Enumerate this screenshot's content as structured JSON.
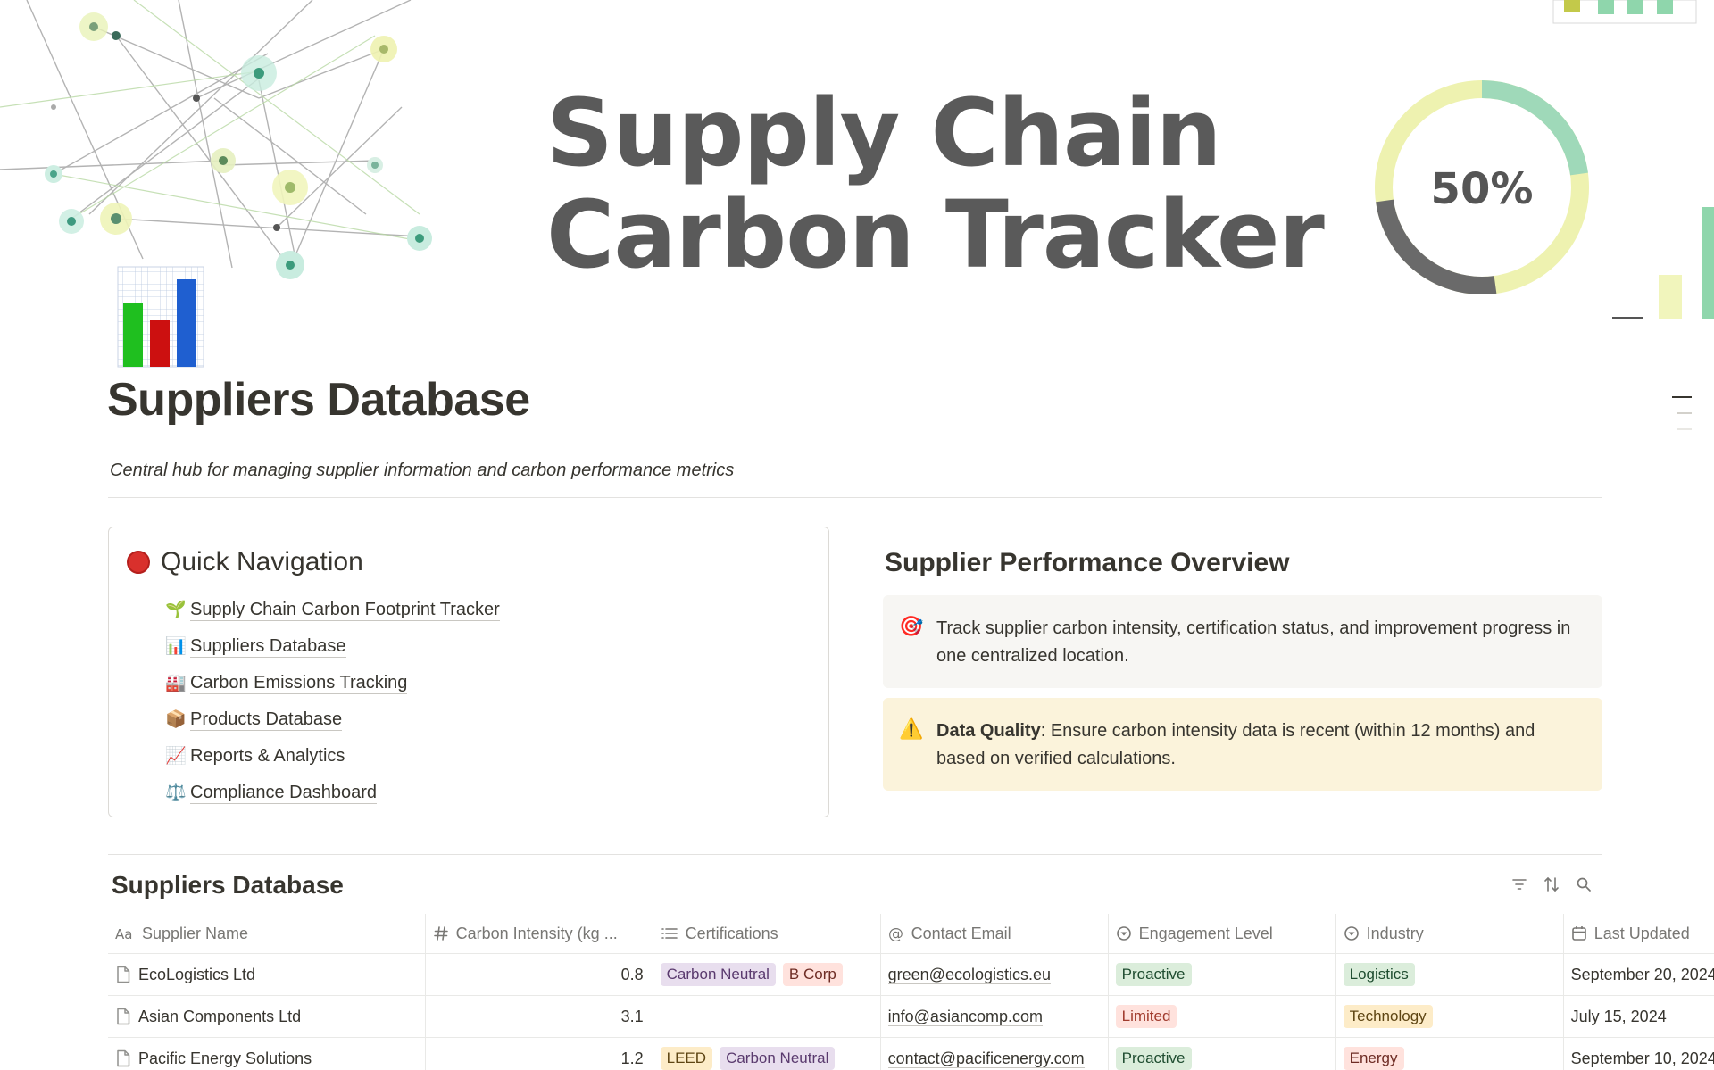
{
  "cover": {
    "title_line1": "Supply Chain",
    "title_line2": "Carbon Tracker",
    "donut_label": "50%",
    "donut_percent": 50
  },
  "page": {
    "icon": "bar-chart-icon",
    "title": "Suppliers Database",
    "subtitle": "Central hub for managing supplier information and carbon performance metrics"
  },
  "quick_nav": {
    "heading": "Quick Navigation",
    "items": [
      {
        "emoji": "🌱",
        "label": "Supply Chain Carbon Footprint Tracker"
      },
      {
        "emoji": "📊",
        "label": "Suppliers Database"
      },
      {
        "emoji": "🏭",
        "label": "Carbon Emissions Tracking"
      },
      {
        "emoji": "📦",
        "label": "Products Database"
      },
      {
        "emoji": "📈",
        "label": "Reports & Analytics"
      },
      {
        "emoji": "⚖️",
        "label": "Compliance Dashboard"
      }
    ]
  },
  "overview": {
    "title": "Supplier Performance Overview",
    "callout_info": {
      "emoji": "🎯",
      "text": "Track supplier carbon intensity, certification status, and improvement progress in one centralized location."
    },
    "callout_warn": {
      "emoji": "⚠️",
      "bold": "Data Quality",
      "text": ": Ensure carbon intensity data is recent (within 12 months) and based on verified calculations."
    }
  },
  "database": {
    "title": "Suppliers Database",
    "columns": [
      "Supplier Name",
      "Carbon Intensity (kg ...",
      "Certifications",
      "Contact Email",
      "Engagement Level",
      "Industry",
      "Last Updated"
    ],
    "rows": [
      {
        "name": "EcoLogistics Ltd",
        "intensity": "0.8",
        "certs": [
          {
            "label": "Carbon Neutral",
            "color": "purple"
          },
          {
            "label": "B Corp",
            "color": "red"
          }
        ],
        "email": "green@ecologistics.eu",
        "engagement": {
          "label": "Proactive",
          "color": "green"
        },
        "industry": {
          "label": "Logistics",
          "color": "green"
        },
        "updated": "September 20, 2024"
      },
      {
        "name": "Asian Components Ltd",
        "intensity": "3.1",
        "certs": [],
        "email": "info@asiancomp.com",
        "engagement": {
          "label": "Limited",
          "color": "pink-red"
        },
        "industry": {
          "label": "Technology",
          "color": "yellow"
        },
        "updated": "July 15, 2024"
      },
      {
        "name": "Pacific Energy Solutions",
        "intensity": "1.2",
        "certs": [
          {
            "label": "LEED",
            "color": "yellow"
          },
          {
            "label": "Carbon Neutral",
            "color": "purple"
          }
        ],
        "email": "contact@pacificenergy.com",
        "engagement": {
          "label": "Proactive",
          "color": "green"
        },
        "industry": {
          "label": "Energy",
          "color": "red"
        },
        "updated": "September 10, 2024"
      }
    ]
  }
}
